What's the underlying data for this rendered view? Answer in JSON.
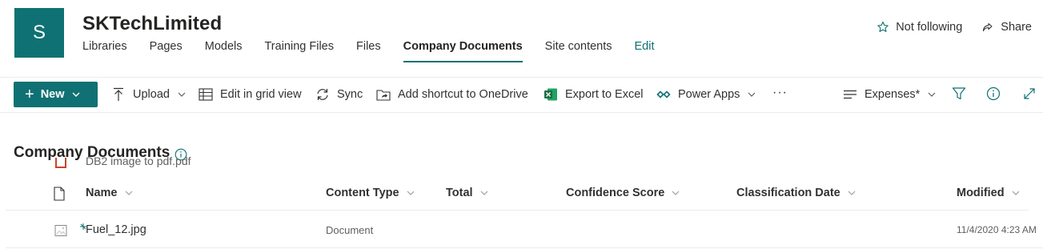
{
  "site": {
    "logo_letter": "S",
    "title": "SKTechLimited",
    "nav": [
      {
        "label": "Libraries"
      },
      {
        "label": "Pages"
      },
      {
        "label": "Models"
      },
      {
        "label": "Training Files"
      },
      {
        "label": "Files"
      },
      {
        "label": "Company Documents",
        "active": true
      },
      {
        "label": "Site contents"
      },
      {
        "label": "Edit"
      }
    ],
    "actions": {
      "follow_label": "Not following",
      "share_label": "Share"
    }
  },
  "command_bar": {
    "new_label": "New",
    "upload_label": "Upload",
    "grid_label": "Edit in grid view",
    "sync_label": "Sync",
    "shortcut_label": "Add shortcut to OneDrive",
    "export_label": "Export to Excel",
    "powerapps_label": "Power Apps",
    "more_label": "···",
    "view_label": "Expenses*"
  },
  "list": {
    "title": "Company Documents",
    "ghost_row_name": "DB2 image to pdf.pdf",
    "columns": [
      {
        "label": "Name"
      },
      {
        "label": "Content Type"
      },
      {
        "label": "Total"
      },
      {
        "label": "Confidence Score"
      },
      {
        "label": "Classification Date"
      },
      {
        "label": "Modified"
      }
    ],
    "rows": [
      {
        "name": "Fuel_12.jpg",
        "content_type": "Document",
        "total": "",
        "confidence": "",
        "classification_date": "",
        "modified": "11/4/2020 4:23 AM"
      }
    ]
  },
  "colors": {
    "accent": "#0f7173",
    "text": "#323130",
    "divider": "#edebe9",
    "excel_green": "#1d6f42"
  }
}
